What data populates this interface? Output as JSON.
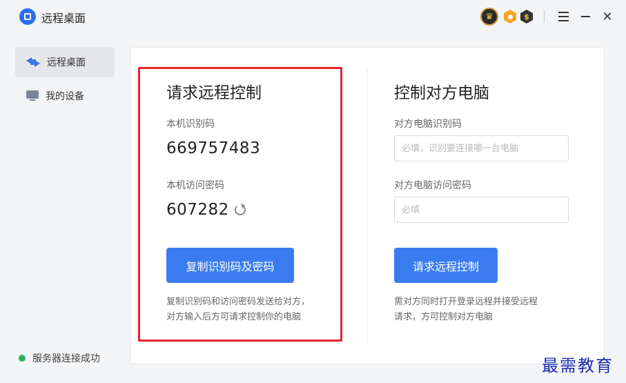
{
  "app": {
    "title": "远程桌面"
  },
  "titlebar": {
    "coin_symbol": "$",
    "crown_symbol": "♛",
    "menu_label": "menu",
    "close_symbol": "✕"
  },
  "sidebar": {
    "items": [
      {
        "label": "远程桌面",
        "icon": "remote-desktop-icon",
        "active": true
      },
      {
        "label": "我的设备",
        "icon": "monitor-icon",
        "active": false
      }
    ],
    "status": {
      "text": "服务器连接成功",
      "color": "#2db55d"
    }
  },
  "local": {
    "title": "请求远程控制",
    "id_label": "本机识别码",
    "id_value": "669757483",
    "password_label": "本机访问密码",
    "password_value": "607282",
    "copy_button": "复制识别码及密码",
    "hint_line1": "复制识别码和访问密码发送给对方，",
    "hint_line2": "对方输入后方可请求控制你的电脑"
  },
  "remote": {
    "title": "控制对方电脑",
    "id_label": "对方电脑识别码",
    "id_placeholder": "必填，识别要连接哪一台电脑",
    "password_label": "对方电脑访问密码",
    "password_placeholder": "必填",
    "request_button": "请求远程控制",
    "hint_line1": "需对方同时打开登录远程并接受远程",
    "hint_line2": "请求，方可控制对方电脑"
  },
  "watermark": {
    "text": "最需教育"
  },
  "colors": {
    "accent": "#3a7cf0",
    "highlight_border": "#e8222b",
    "watermark": "#1a2ab0"
  }
}
